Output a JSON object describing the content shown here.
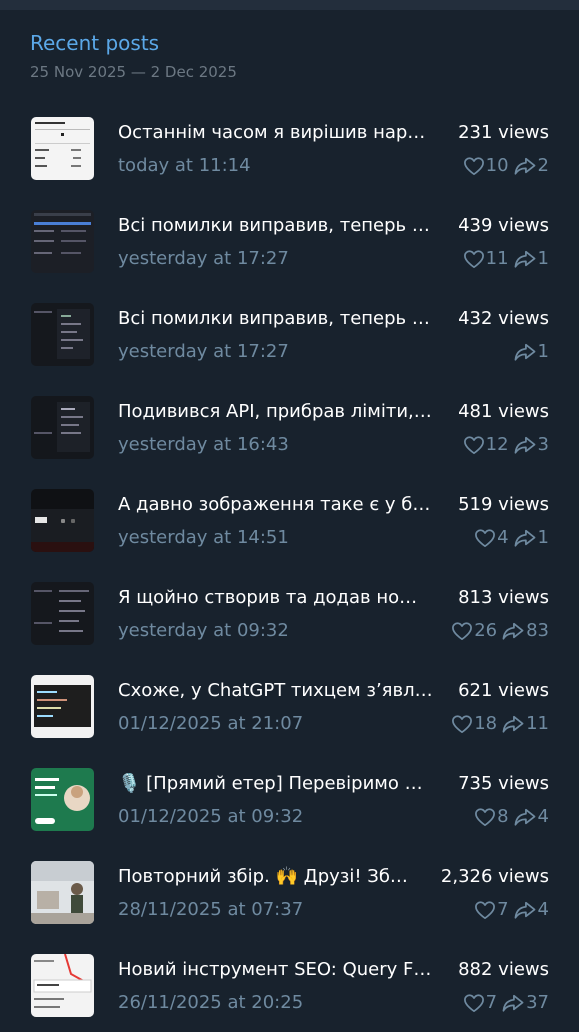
{
  "header": {
    "title": "Recent posts",
    "date_range": "25 Nov 2025 — 2 Dec 2025"
  },
  "posts": [
    {
      "title": "Останнім часом я вирішив нар…",
      "date": "today at 11:14",
      "views": "231 views",
      "likes": "10",
      "shares": "2",
      "thumb_icon": "light-screenshot-thumbnail"
    },
    {
      "title": "Всі помилки виправив, теперь …",
      "date": "yesterday at 17:27",
      "views": "439 views",
      "likes": "11",
      "shares": "1",
      "thumb_icon": "dark-screenshot-thumbnail"
    },
    {
      "title": "Всі помилки виправив, теперь …",
      "date": "yesterday at 17:27",
      "views": "432 views",
      "likes": "",
      "shares": "1",
      "thumb_icon": "dark-screenshot-thumbnail"
    },
    {
      "title": "Подивився API, прибрав ліміти,…",
      "date": "yesterday at 16:43",
      "views": "481 views",
      "likes": "12",
      "shares": "3",
      "thumb_icon": "dark-screenshot-thumbnail"
    },
    {
      "title": "А давно зображення таке є у бл…",
      "date": "yesterday at 14:51",
      "views": "519 views",
      "likes": "4",
      "shares": "1",
      "thumb_icon": "dark-screenshot-thumbnail"
    },
    {
      "title": "Я щойно створив та додав но…",
      "date": "yesterday at 09:32",
      "views": "813 views",
      "likes": "26",
      "shares": "83",
      "thumb_icon": "dark-screenshot-thumbnail"
    },
    {
      "title": "Схоже, у ChatGPT тихцем з’явл…",
      "date": "01/12/2025 at 21:07",
      "views": "621 views",
      "likes": "18",
      "shares": "11",
      "thumb_icon": "code-screenshot-thumbnail"
    },
    {
      "title": "🎙️ [Прямий етер] Перевіримо …",
      "date": "01/12/2025 at 09:32",
      "views": "735 views",
      "likes": "8",
      "shares": "4",
      "thumb_icon": "green-banner-thumbnail"
    },
    {
      "title": "Повторний збір. 🙌 Друзі! Зб…",
      "date": "28/11/2025 at 07:37",
      "views": "2,326 views",
      "likes": "7",
      "shares": "4",
      "thumb_icon": "photo-thumbnail"
    },
    {
      "title": "Новий інструмент SEO: Query F…",
      "date": "26/11/2025 at 20:25",
      "views": "882 views",
      "likes": "7",
      "shares": "37",
      "thumb_icon": "light-screenshot-thumbnail"
    }
  ],
  "colors": {
    "background": "#18222d",
    "accent": "#5ba8e8",
    "muted": "#6f8aa0",
    "text": "#ffffff"
  }
}
